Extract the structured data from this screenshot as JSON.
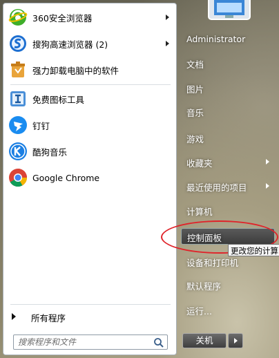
{
  "left_panel": {
    "pinned": [
      {
        "label": "360安全浏览器",
        "icon": "360-browser-icon",
        "has_submenu": true
      },
      {
        "label": "搜狗高速浏览器 (2)",
        "icon": "sogou-browser-icon",
        "has_submenu": true
      },
      {
        "label": "强力卸载电脑中的软件",
        "icon": "uninstaller-icon",
        "has_submenu": false
      }
    ],
    "recent": [
      {
        "label": "免费图标工具",
        "icon": "icon-tool-icon"
      },
      {
        "label": "钉钉",
        "icon": "dingtalk-icon"
      },
      {
        "label": "酷狗音乐",
        "icon": "kugou-icon"
      },
      {
        "label": "Google Chrome",
        "icon": "chrome-icon"
      }
    ],
    "all_programs": "所有程序",
    "search_placeholder": "搜索程序和文件"
  },
  "right_panel": {
    "items": [
      {
        "label": "Administrator",
        "has_submenu": false
      },
      {
        "label": "文档",
        "has_submenu": false
      },
      {
        "label": "图片",
        "has_submenu": false
      },
      {
        "label": "音乐",
        "has_submenu": false
      },
      {
        "label": "游戏",
        "has_submenu": false
      },
      {
        "label": "收藏夹",
        "has_submenu": true
      },
      {
        "label": "最近使用的项目",
        "has_submenu": true
      },
      {
        "label": "计算机",
        "has_submenu": false
      },
      {
        "label": "控制面板",
        "has_submenu": false,
        "highlighted": true
      },
      {
        "label": "设备和打印机",
        "has_submenu": false
      },
      {
        "label": "默认程序",
        "has_submenu": false
      },
      {
        "label": "运行...",
        "has_submenu": false
      }
    ],
    "tooltip": "更改您的计算",
    "shutdown_label": "关机"
  },
  "colors": {
    "annotation_circle": "#e0232a",
    "highlight": "#3c3c3c"
  }
}
